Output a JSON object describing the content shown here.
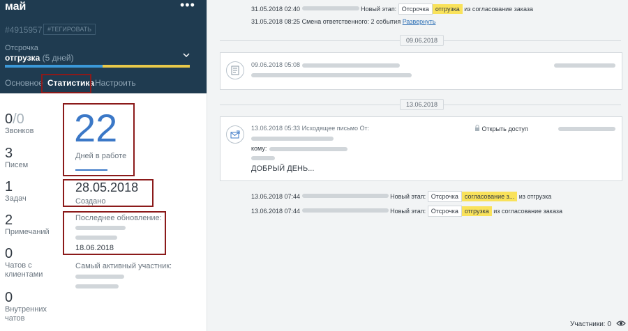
{
  "header": {
    "title": "май",
    "menu": "•••",
    "deal_id": "#4915957",
    "tag_button": "#ТЕГИРОВАТЬ",
    "status_label": "Отсрочка",
    "status_value": "отгрузка",
    "status_days": "(5 дней)",
    "pipeline_colors": [
      "#3b99d9",
      "#3b99d9",
      "#e8c94a",
      "#e8c94a"
    ]
  },
  "tabs": [
    {
      "label": "Основное"
    },
    {
      "label": "Статистика"
    },
    {
      "label": "Настроить"
    }
  ],
  "stats": [
    {
      "value": "0",
      "value_dim": "/0",
      "label": "Звонков"
    },
    {
      "value": "3",
      "label": "Писем"
    },
    {
      "value": "1",
      "label": "Задач"
    },
    {
      "value": "2",
      "label": "Примечаний"
    },
    {
      "value": "0",
      "label": "Чатов с клиентами"
    },
    {
      "value": "0",
      "label": "Внутренних чатов"
    }
  ],
  "summary": {
    "days_value": "22",
    "days_label": "Дней в работе",
    "created_date": "28.05.2018",
    "created_label": "Создано",
    "updated_label": "Последнее обновление:",
    "updated_date": "18.06.2018",
    "active_label": "Самый активный участник:"
  },
  "feed": {
    "row1": {
      "datetime": "31.05.2018 02:40",
      "text": "Новый этап:",
      "from_stage": "Отсрочка",
      "stage": "отгрузка",
      "suffix": "из согласование заказа"
    },
    "row2": {
      "datetime": "31.05.2018 08:25",
      "text": "Смена ответственного: 2 события",
      "link": "Развернуть"
    },
    "sep1": "09.06.2018",
    "card1": {
      "datetime": "09.06.2018 05:08"
    },
    "sep2": "13.06.2018",
    "card2": {
      "datetime": "13.06.2018 05:33",
      "text": "Исходящее письмо От:",
      "open_access": "Открыть доступ",
      "to": "кому:",
      "greeting": "ДОБРЫЙ ДЕНЬ..."
    },
    "row3": {
      "datetime": "13.06.2018 07:44",
      "text": "Новый этап:",
      "from_stage": "Отсрочка",
      "stage": "согласование з...",
      "suffix": "из отгрузка"
    },
    "row4": {
      "datetime": "13.06.2018 07:44",
      "text": "Новый этап:",
      "from_stage": "Отсрочка",
      "stage": "отгрузка",
      "suffix": "из согласование заказа"
    }
  },
  "footer": {
    "participants": "Участники: 0"
  }
}
